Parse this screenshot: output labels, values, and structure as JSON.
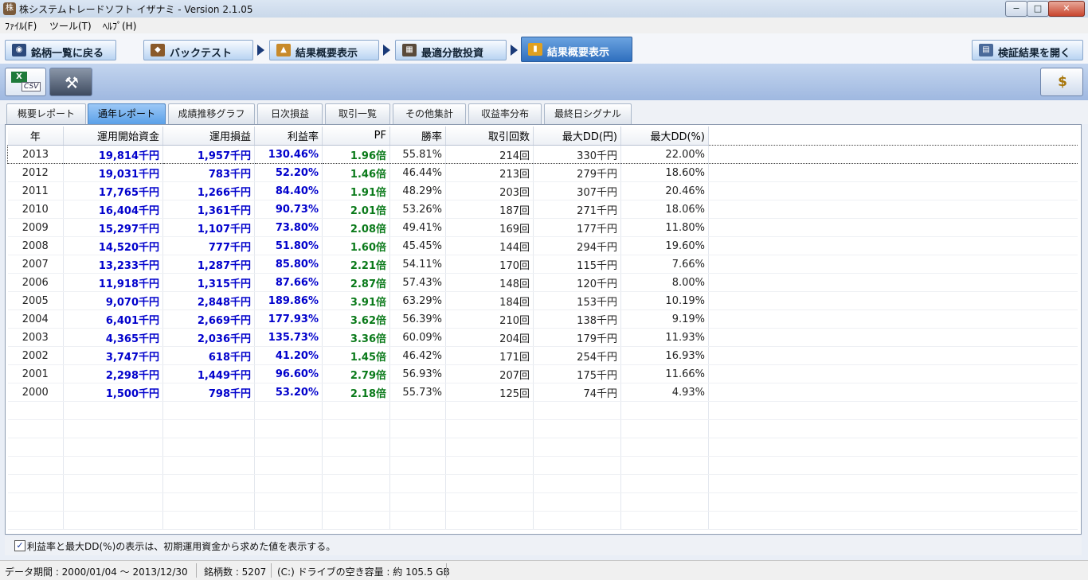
{
  "window": {
    "title": "株システムトレードソフト イザナミ - Version 2.1.05",
    "app_icon": "app-icon",
    "minimize": "−",
    "maximize": "□",
    "close": "✕"
  },
  "menu": {
    "items": [
      "ﾌｧｲﾙ(F)",
      "ツール(T)",
      "ﾍﾙﾌﾟ(H)"
    ]
  },
  "workflow": {
    "back": {
      "label": "銘柄一覧に戻る",
      "icon": "eye-icon"
    },
    "backtest": {
      "label": "バックテスト",
      "icon": "bag-icon"
    },
    "summary": {
      "label": "結果概要表示",
      "icon": "chart-hand-icon"
    },
    "optimize": {
      "label": "最適分散投資",
      "icon": "calculator-icon"
    },
    "active": {
      "label": "結果概要表示",
      "icon": "bar-chart-icon"
    },
    "open_results": {
      "label": "検証結果を開く",
      "icon": "open-icon"
    }
  },
  "actions": {
    "csv_text": "CSV",
    "excel_mark": "X",
    "tools_glyph": "⚒",
    "money_glyph": "$"
  },
  "tabs": [
    "概要レポート",
    "通年レポート",
    "成績推移グラフ",
    "日次損益",
    "取引一覧",
    "その他集計",
    "収益率分布",
    "最終日シグナル"
  ],
  "table": {
    "headers": [
      "年",
      "運用開始資金",
      "運用損益",
      "利益率",
      "PF",
      "勝率",
      "取引回数",
      "最大DD(円)",
      "最大DD(%)"
    ],
    "rows": [
      [
        "2013",
        "19,814千円",
        "1,957千円",
        "130.46%",
        "1.96倍",
        "55.81%",
        "214回",
        "330千円",
        "22.00%"
      ],
      [
        "2012",
        "19,031千円",
        "783千円",
        "52.20%",
        "1.46倍",
        "46.44%",
        "213回",
        "279千円",
        "18.60%"
      ],
      [
        "2011",
        "17,765千円",
        "1,266千円",
        "84.40%",
        "1.91倍",
        "48.29%",
        "203回",
        "307千円",
        "20.46%"
      ],
      [
        "2010",
        "16,404千円",
        "1,361千円",
        "90.73%",
        "2.01倍",
        "53.26%",
        "187回",
        "271千円",
        "18.06%"
      ],
      [
        "2009",
        "15,297千円",
        "1,107千円",
        "73.80%",
        "2.08倍",
        "49.41%",
        "169回",
        "177千円",
        "11.80%"
      ],
      [
        "2008",
        "14,520千円",
        "777千円",
        "51.80%",
        "1.60倍",
        "45.45%",
        "144回",
        "294千円",
        "19.60%"
      ],
      [
        "2007",
        "13,233千円",
        "1,287千円",
        "85.80%",
        "2.21倍",
        "54.11%",
        "170回",
        "115千円",
        "7.66%"
      ],
      [
        "2006",
        "11,918千円",
        "1,315千円",
        "87.66%",
        "2.87倍",
        "57.43%",
        "148回",
        "120千円",
        "8.00%"
      ],
      [
        "2005",
        "9,070千円",
        "2,848千円",
        "189.86%",
        "3.91倍",
        "63.29%",
        "184回",
        "153千円",
        "10.19%"
      ],
      [
        "2004",
        "6,401千円",
        "2,669千円",
        "177.93%",
        "3.62倍",
        "56.39%",
        "210回",
        "138千円",
        "9.19%"
      ],
      [
        "2003",
        "4,365千円",
        "2,036千円",
        "135.73%",
        "3.36倍",
        "60.09%",
        "204回",
        "179千円",
        "11.93%"
      ],
      [
        "2002",
        "3,747千円",
        "618千円",
        "41.20%",
        "1.45倍",
        "46.42%",
        "171回",
        "254千円",
        "16.93%"
      ],
      [
        "2001",
        "2,298千円",
        "1,449千円",
        "96.60%",
        "2.79倍",
        "56.93%",
        "207回",
        "175千円",
        "11.66%"
      ],
      [
        "2000",
        "1,500千円",
        "798千円",
        "53.20%",
        "2.18倍",
        "55.73%",
        "125回",
        "74千円",
        "4.93%"
      ]
    ]
  },
  "option": {
    "checked": true,
    "check_glyph": "✓",
    "label": "利益率と最大DD(%)の表示は、初期運用資金から求めた値を表示する。"
  },
  "status": {
    "period": "データ期間 : 2000/01/04 〜 2013/12/30",
    "stocks": "銘柄数 : 5207",
    "disk": "(C:) ドライブの空き容量 : 約 105.5 GB"
  },
  "colors": {
    "value_blue": "#0000cc",
    "pf_green": "#0a7a1a",
    "active_tab": "#5aa0e8"
  }
}
